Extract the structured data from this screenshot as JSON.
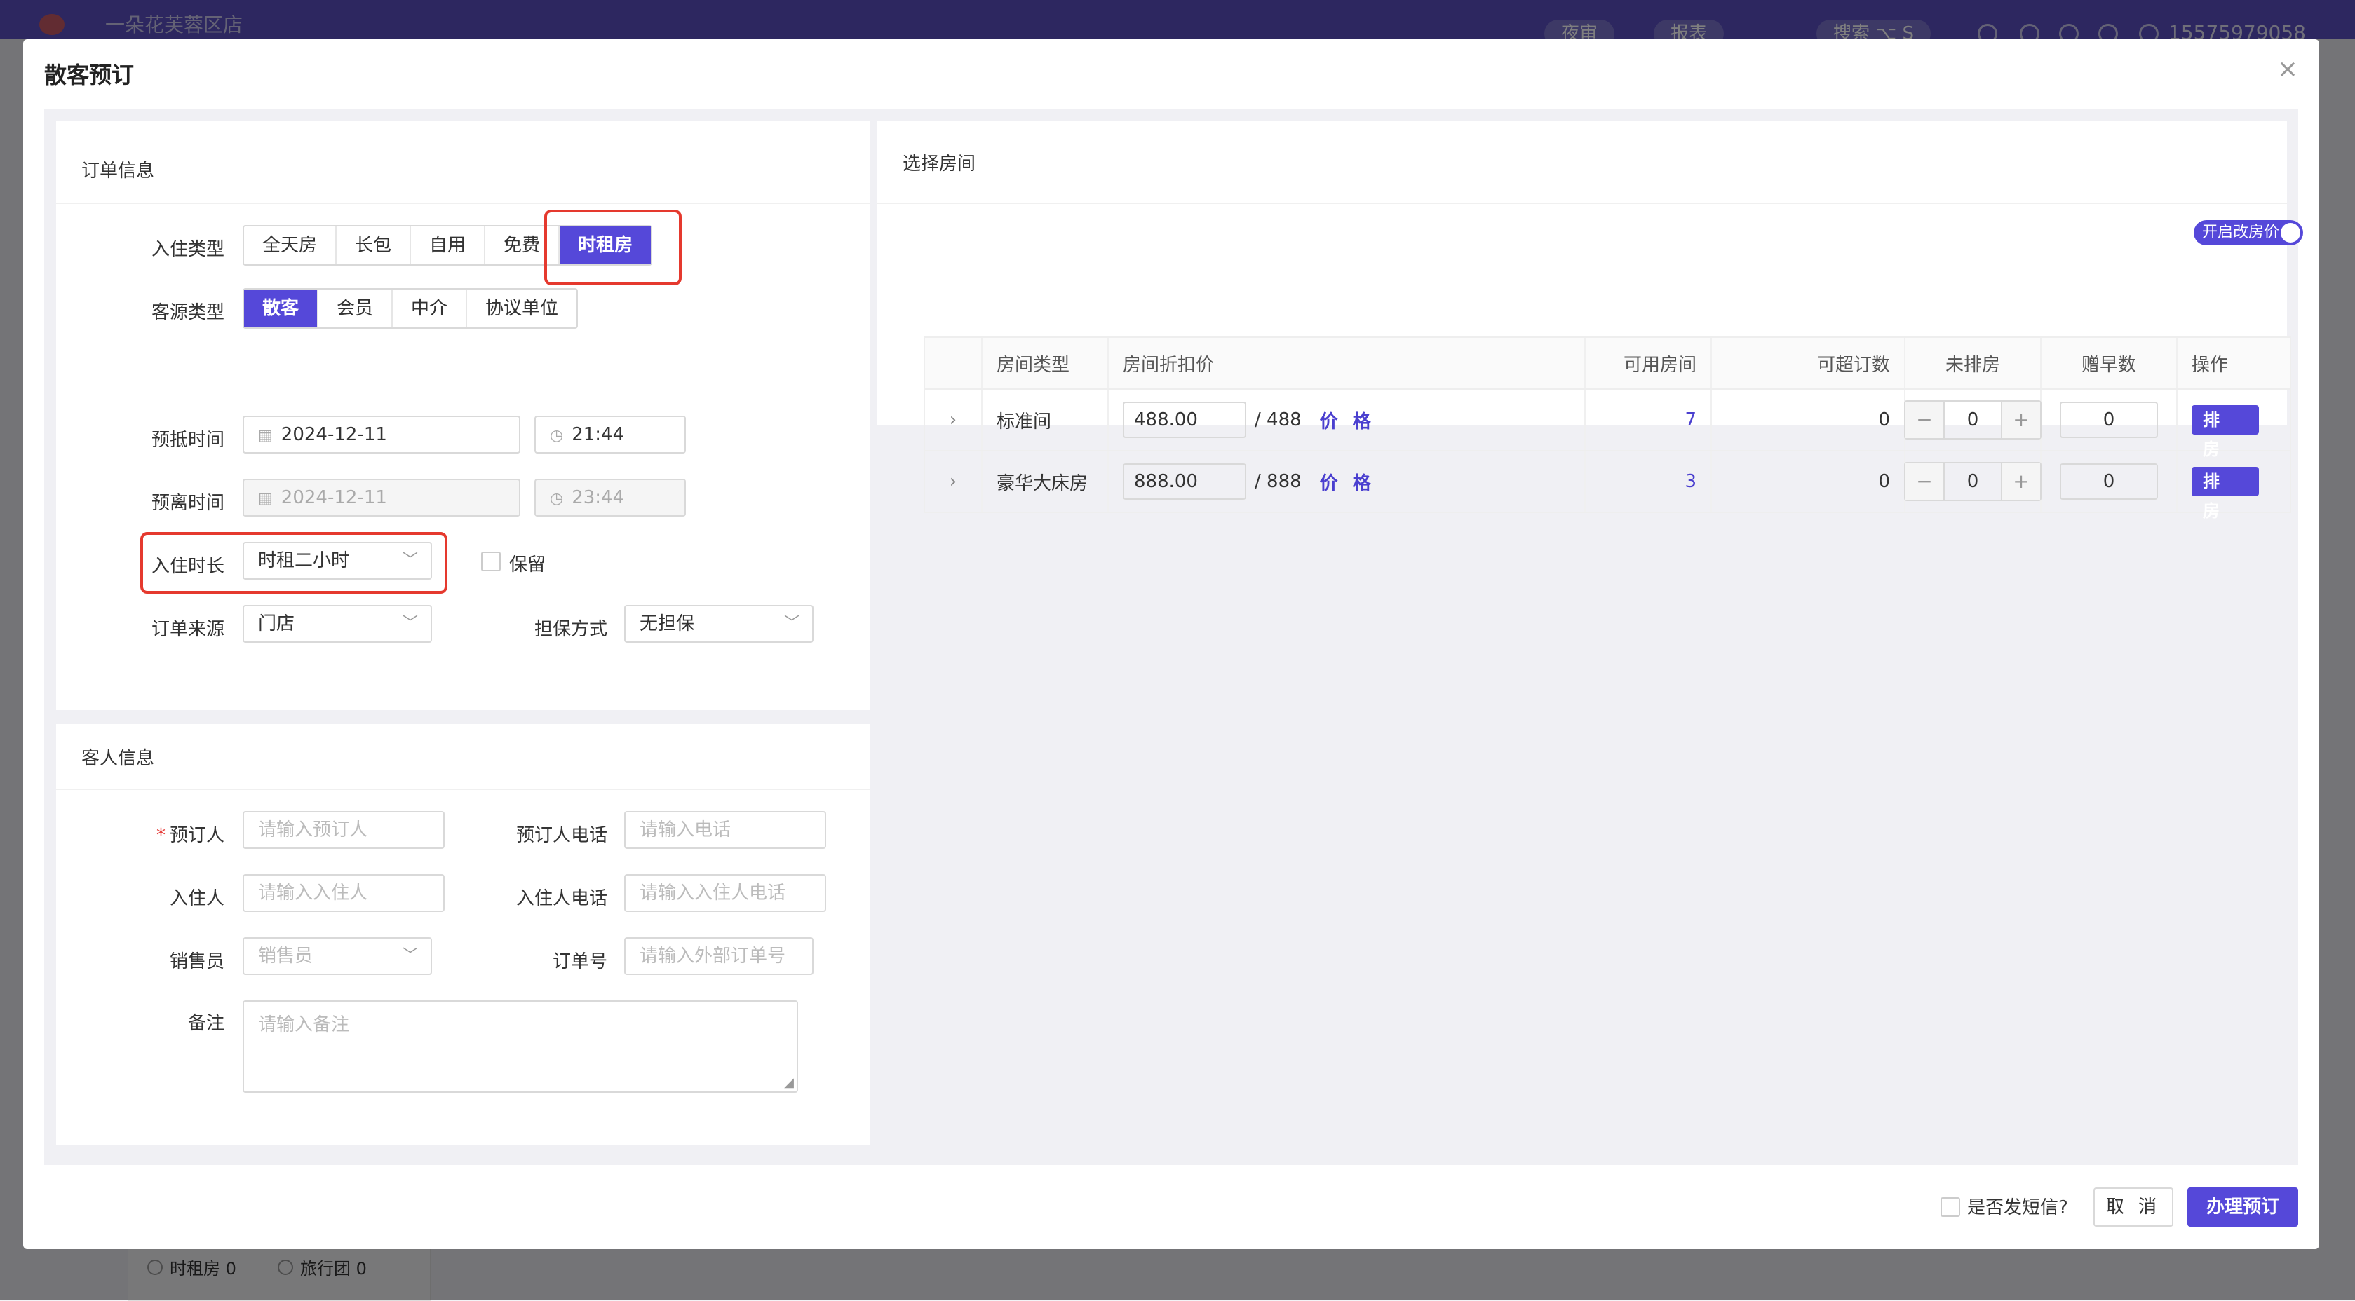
{
  "app": {
    "store": "一朵花芙蓉区店",
    "pills": [
      "夜审",
      "报表",
      "搜索"
    ],
    "search_shortcut": "⌥ S",
    "phone": "15575979058",
    "bottom_chips": [
      "时租房 0",
      "旅行团 0"
    ]
  },
  "modal": {
    "title": "散客预订",
    "close": "×"
  },
  "order": {
    "title": "订单信息",
    "checkin_type_label": "入住类型",
    "checkin_types": [
      "全天房",
      "长包",
      "自用",
      "免费",
      "时租房"
    ],
    "checkin_type_selected": "时租房",
    "guest_type_label": "客源类型",
    "guest_types": [
      "散客",
      "会员",
      "中介",
      "协议单位"
    ],
    "guest_type_selected": "散客",
    "arrive_label": "预抵时间",
    "arrive_date": "2024-12-11",
    "arrive_time": "21:44",
    "leave_label": "预离时间",
    "leave_date": "2024-12-11",
    "leave_time": "23:44",
    "duration_label": "入住时长",
    "duration_value": "时租二小时",
    "keep_label": "保留",
    "source_label": "订单来源",
    "source_value": "门店",
    "guarantee_label": "担保方式",
    "guarantee_value": "无担保"
  },
  "guest": {
    "title": "客人信息",
    "booker_label": "预订人",
    "booker_placeholder": "请输入预订人",
    "booker_phone_label": "预订人电话",
    "booker_phone_placeholder": "请输入电话",
    "resident_label": "入住人",
    "resident_placeholder": "请输入入住人",
    "resident_phone_label": "入住人电话",
    "resident_phone_placeholder": "请输入入住人电话",
    "sales_label": "销售员",
    "sales_placeholder": "销售员",
    "order_no_label": "订单号",
    "order_no_placeholder": "请输入外部订单号",
    "remark_label": "备注",
    "remark_placeholder": "请输入备注"
  },
  "rooms": {
    "title": "选择房间",
    "toggle_label": "开启改房价",
    "toggle_on": true,
    "columns": [
      "房间类型",
      "房间折扣价",
      "可用房间",
      "可超订数",
      "未排房",
      "赠早数",
      "操作"
    ],
    "price_link": "价 格",
    "action_label": "排 房",
    "rows": [
      {
        "type": "标准间",
        "discount_price": "488.00",
        "base_price": "/ 488",
        "available": "7",
        "overbook": "0",
        "unassigned": "0",
        "breakfast": "0"
      },
      {
        "type": "豪华大床房",
        "discount_price": "888.00",
        "base_price": "/ 888",
        "available": "3",
        "overbook": "0",
        "unassigned": "0",
        "breakfast": "0"
      }
    ]
  },
  "footer": {
    "sms_label": "是否发短信?",
    "cancel_label": "取 消",
    "submit_label": "办理预订"
  }
}
